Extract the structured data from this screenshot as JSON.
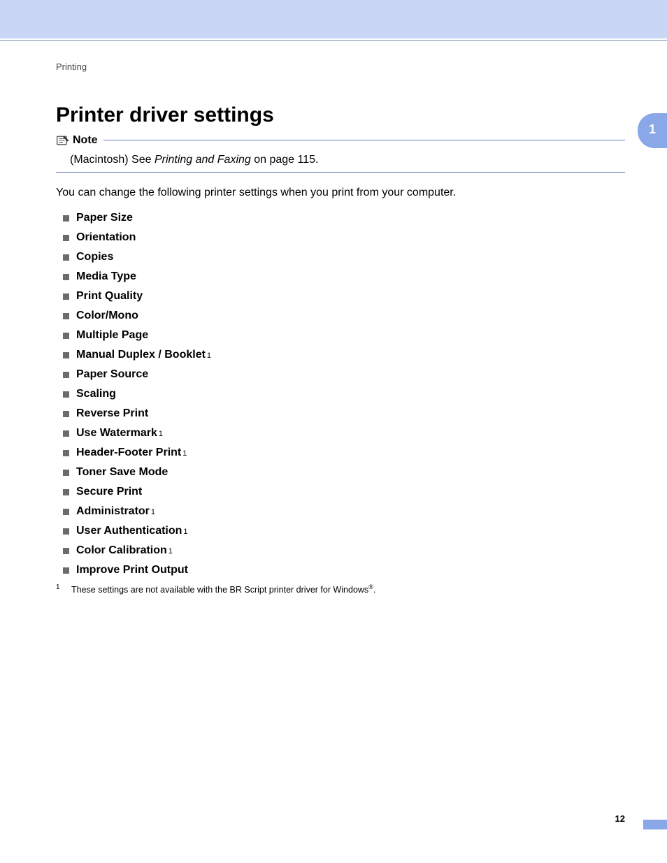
{
  "breadcrumb": "Printing",
  "title": "Printer driver settings",
  "chapter_tab": "1",
  "note": {
    "label": "Note",
    "prefix": "(Macintosh) See ",
    "link_text": "Printing and Faxing",
    "suffix": " on page 115."
  },
  "intro": "You can change the following printer settings when you print from your computer.",
  "settings": [
    {
      "label": "Paper Size",
      "fn": ""
    },
    {
      "label": "Orientation",
      "fn": ""
    },
    {
      "label": "Copies",
      "fn": ""
    },
    {
      "label": "Media Type",
      "fn": ""
    },
    {
      "label": "Print Quality",
      "fn": ""
    },
    {
      "label": "Color/Mono",
      "fn": ""
    },
    {
      "label": "Multiple Page",
      "fn": ""
    },
    {
      "label": "Manual Duplex / Booklet",
      "fn": "1"
    },
    {
      "label": "Paper Source",
      "fn": ""
    },
    {
      "label": "Scaling",
      "fn": ""
    },
    {
      "label": "Reverse Print",
      "fn": ""
    },
    {
      "label": "Use Watermark",
      "fn": "1"
    },
    {
      "label": "Header-Footer Print",
      "fn": "1"
    },
    {
      "label": "Toner Save Mode",
      "fn": ""
    },
    {
      "label": "Secure Print",
      "fn": ""
    },
    {
      "label": "Administrator",
      "fn": "1"
    },
    {
      "label": "User Authentication",
      "fn": "1"
    },
    {
      "label": "Color Calibration",
      "fn": "1"
    },
    {
      "label": "Improve Print Output",
      "fn": ""
    }
  ],
  "footnote": {
    "num": "1",
    "text_before": "These settings are not available with the BR Script printer driver for Windows",
    "reg": "®",
    "text_after": "."
  },
  "page_number": "12"
}
